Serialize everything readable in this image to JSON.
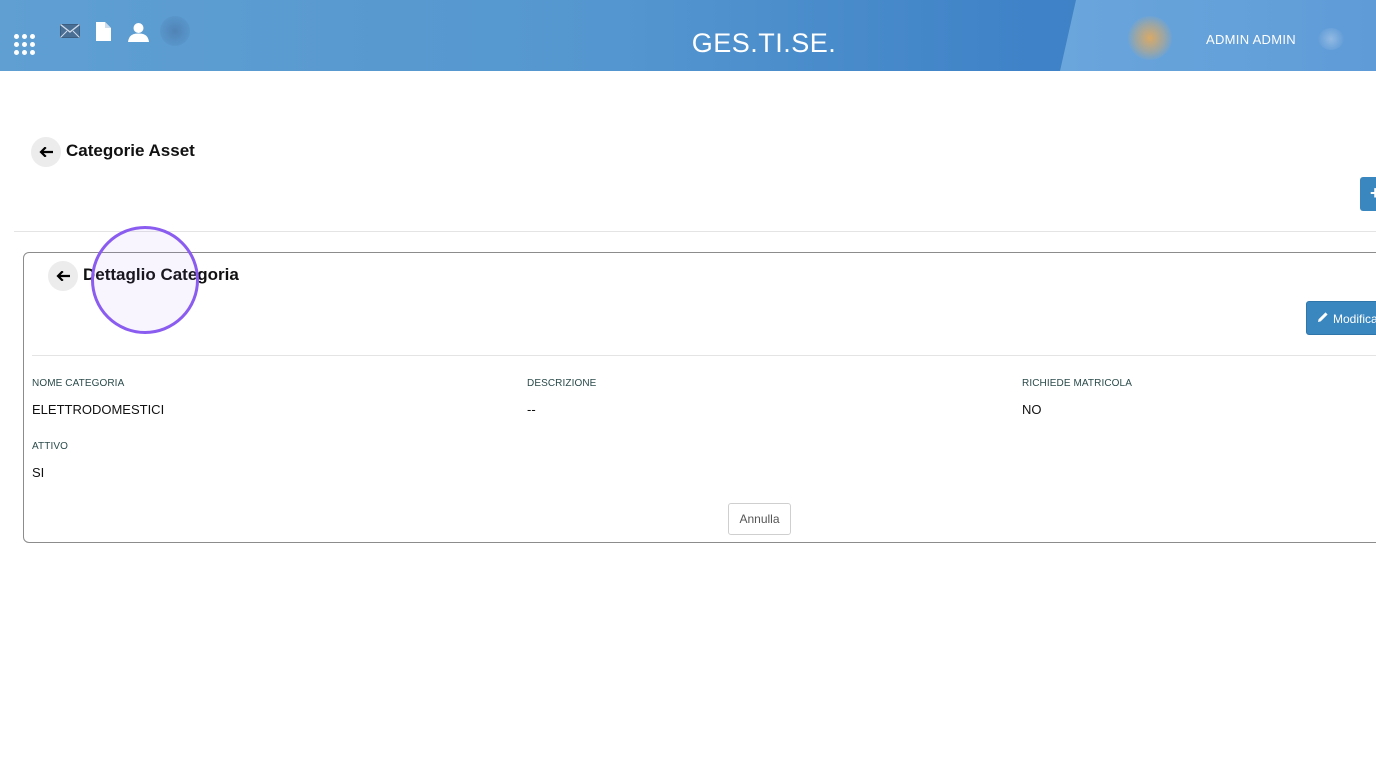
{
  "app": {
    "brand": "GES.TI.SE.",
    "user_name": "ADMIN ADMIN"
  },
  "page": {
    "title": "Categorie Asset"
  },
  "card": {
    "title": "Dettaglio Categoria",
    "edit_label": "Modifica",
    "cancel_label": "Annulla",
    "fields": [
      {
        "label": "NOME CATEGORIA",
        "value": "ELETTRODOMESTICI"
      },
      {
        "label": "DESCRIZIONE",
        "value": "--"
      },
      {
        "label": "RICHIEDE MATRICOLA",
        "value": "NO"
      },
      {
        "label": "ATTIVO",
        "value": "SI"
      }
    ]
  },
  "icons": {
    "apps": "grid-icon",
    "mail": "mail-icon",
    "document": "document-icon",
    "user": "user-icon",
    "back": "arrow-left-icon",
    "add": "plus-icon",
    "edit": "pencil-icon"
  },
  "colors": {
    "topbar": "#5496cf",
    "primary_button": "#3a87c0",
    "cursor_ring": "#8a5cf0"
  }
}
